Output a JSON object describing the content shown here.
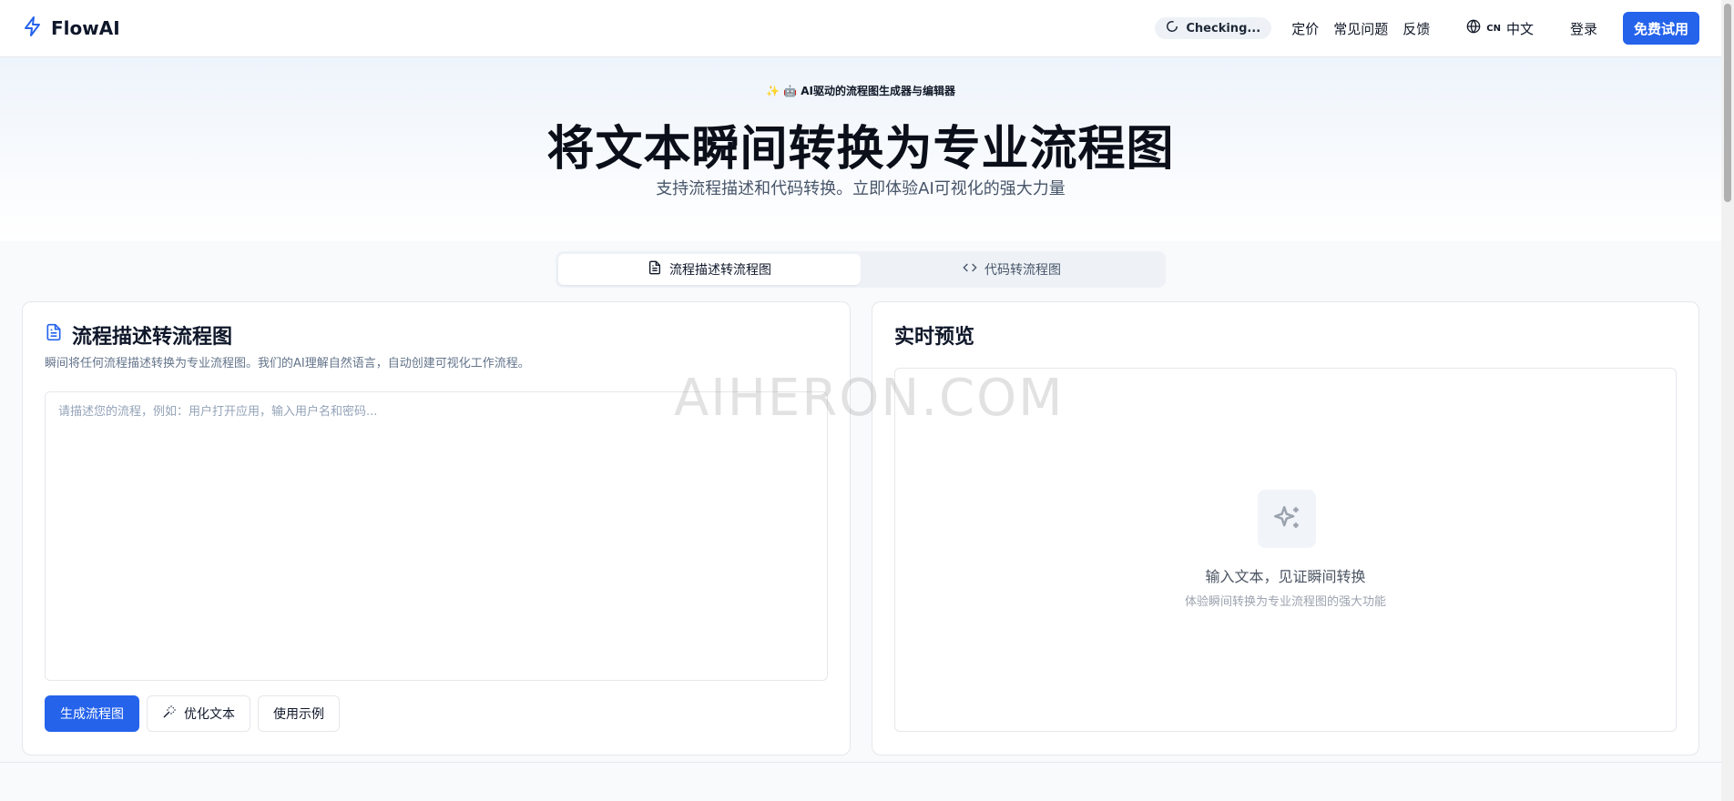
{
  "header": {
    "brand": "FlowAI",
    "status": "Checking...",
    "nav": [
      "定价",
      "常见问题",
      "反馈"
    ],
    "lang_code": "CN",
    "lang_label": "中文",
    "login": "登录",
    "cta": "免费试用"
  },
  "hero": {
    "badge": "AI驱动的流程图生成器与编辑器",
    "title": "将文本瞬间转换为专业流程图",
    "subtitle": "支持流程描述和代码转换。立即体验AI可视化的强大力量"
  },
  "tabs": [
    {
      "label": "流程描述转流程图",
      "icon": "document-icon",
      "active": true
    },
    {
      "label": "代码转流程图",
      "icon": "code-icon",
      "active": false
    }
  ],
  "editor": {
    "title": "流程描述转流程图",
    "description": "瞬间将任何流程描述转换为专业流程图。我们的AI理解自然语言，自动创建可视化工作流程。",
    "placeholder": "请描述您的流程，例如：用户打开应用，输入用户名和密码...",
    "buttons": {
      "generate": "生成流程图",
      "optimize": "优化文本",
      "example": "使用示例"
    }
  },
  "preview": {
    "title": "实时预览",
    "main": "输入文本，见证瞬间转换",
    "sub": "体验瞬间转换为专业流程图的强大功能"
  },
  "watermark": "AIHERON.COM",
  "colors": {
    "accent": "#2563eb"
  }
}
